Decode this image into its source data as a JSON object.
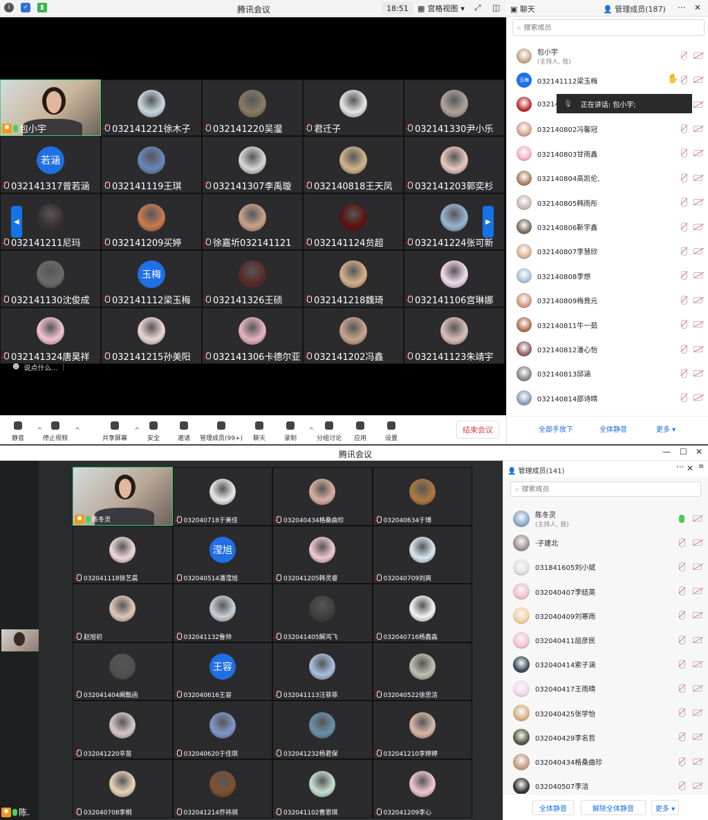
{
  "window1": {
    "title": "腾讯会议",
    "time": "18:51",
    "view_mode": "宫格视图",
    "chat_tab": "聊天",
    "members_tab": "管理成员(187)",
    "search_placeholder": "搜索成员",
    "say_something": "说点什么...",
    "speaking_prefix": "正在讲话: 包小宇;",
    "tiles": [
      {
        "name": "包小宇",
        "kind": "video",
        "c": "#c9b59a"
      },
      {
        "name": "032141221徐木子",
        "kind": "photo",
        "c": "#c8d8e0"
      },
      {
        "name": "032141220吴瀣",
        "kind": "photo",
        "c": "#8a7a66"
      },
      {
        "name": "君迁子",
        "kind": "photo",
        "c": "#e4e4e4"
      },
      {
        "name": "032141330尹小乐",
        "kind": "photo",
        "c": "#b0a49a"
      },
      {
        "name": "032141317曾若涵",
        "kind": "text",
        "avatar_text": "若涵"
      },
      {
        "name": "032141119王琪",
        "kind": "photo",
        "c": "#6a86b8"
      },
      {
        "name": "032141307李禹璇",
        "kind": "photo",
        "c": "#d7d7d7"
      },
      {
        "name": "032140818王天凤",
        "kind": "photo",
        "c": "#d0b48c"
      },
      {
        "name": "032141203郭奕杉",
        "kind": "photo",
        "c": "#e8c8c0"
      },
      {
        "name": "032141211尼玛",
        "kind": "photo",
        "c": "#3a3030"
      },
      {
        "name": "032141209买婷",
        "kind": "photo",
        "c": "#c87a50"
      },
      {
        "name": "徐嘉圻032141121",
        "kind": "photo",
        "c": "#c8a28a"
      },
      {
        "name": "032141124贠超",
        "kind": "photo",
        "c": "#5a1410"
      },
      {
        "name": "032141224张可新",
        "kind": "photo",
        "c": "#9ab4d0"
      },
      {
        "name": "032141130沈俊成",
        "kind": "photo",
        "c": "#6a6a6a"
      },
      {
        "name": "032141112梁玉梅",
        "kind": "text",
        "avatar_text": "玉梅"
      },
      {
        "name": "032141326王硕",
        "kind": "photo",
        "c": "#5a2a2a"
      },
      {
        "name": "032141218魏琦",
        "kind": "photo",
        "c": "#d4b08a"
      },
      {
        "name": "032141106宫琳娜",
        "kind": "photo",
        "c": "#f0dcec"
      },
      {
        "name": "032141324唐昊祥",
        "kind": "photo",
        "c": "#f2c4d0"
      },
      {
        "name": "032141215孙美阳",
        "kind": "photo",
        "c": "#ecd8d4"
      },
      {
        "name": "032141306卡德尔亚",
        "kind": "photo",
        "c": "#e8b4c0"
      },
      {
        "name": "032141202冯鑫",
        "kind": "photo",
        "c": "#caa48e"
      },
      {
        "name": "032141123朱靖宇",
        "kind": "photo",
        "c": "#d8c0b8"
      }
    ],
    "toolbar": [
      {
        "label": "静音",
        "icon": "mic-icon"
      },
      {
        "label": "停止视频",
        "icon": "camera-icon"
      },
      {
        "label": "共享屏幕",
        "icon": "share-screen-icon"
      },
      {
        "label": "安全",
        "icon": "shield-icon"
      },
      {
        "label": "邀请",
        "icon": "add-user-icon"
      },
      {
        "label": "管理成员(99+)",
        "icon": "members-icon"
      },
      {
        "label": "聊天",
        "icon": "chat-icon"
      },
      {
        "label": "录制",
        "icon": "record-icon"
      },
      {
        "label": "分组讨论",
        "icon": "breakout-icon"
      },
      {
        "label": "应用",
        "icon": "apps-icon"
      },
      {
        "label": "设置",
        "icon": "gear-icon"
      }
    ],
    "end_meeting": "结束会议",
    "members": [
      {
        "name": "包小宇",
        "sub": "(主持人, 我)",
        "c": "#c6a890"
      },
      {
        "name": "032141112梁玉梅",
        "text_avatar": "玉梅",
        "hand": true
      },
      {
        "name": "032141",
        "c": "#b83030"
      },
      {
        "name": "032140802冯馨冠",
        "c": "#d2a490"
      },
      {
        "name": "032140803甘雨鑫",
        "c": "#f0b0c8"
      },
      {
        "name": "032140804高凯伦,",
        "c": "#a88060"
      },
      {
        "name": "032140805韩雨彤",
        "c": "#c8b8b0"
      },
      {
        "name": "032140806靳宇鑫",
        "c": "#7a6a5a"
      },
      {
        "name": "032140807李慧欣",
        "c": "#d8b090"
      },
      {
        "name": "032140808李想",
        "c": "#a8c0d8"
      },
      {
        "name": "032140809梅竟元",
        "c": "#d09880"
      },
      {
        "name": "032140811牛一茹",
        "c": "#b07050"
      },
      {
        "name": "032140812潘心怡",
        "c": "#906060"
      },
      {
        "name": "032140813邱涵",
        "c": "#888"
      },
      {
        "name": "032140814邵诗晴",
        "c": "#8aa0b8"
      }
    ],
    "panel_buttons": [
      "全部手放下",
      "全体静音",
      "更多 ▾"
    ]
  },
  "window2": {
    "title": "腾讯会议",
    "members_tab": "管理成员(141)",
    "search_placeholder": "搜索成员",
    "self_name": "陈.",
    "tiles": [
      {
        "name": "陈冬灵",
        "kind": "video",
        "c": "#b8a898"
      },
      {
        "name": "032040718于美佳",
        "kind": "photo",
        "c": "#e8e8e8"
      },
      {
        "name": "032040434格桑曲珍",
        "kind": "photo",
        "c": "#d8b0a0"
      },
      {
        "name": "032040634于博",
        "kind": "photo",
        "c": "#b07a40"
      },
      {
        "name": "032041118徐艺晨",
        "kind": "photo",
        "c": "#f0d8d8"
      },
      {
        "name": "032040514潘滢旭",
        "kind": "text",
        "avatar_text": "滢旭"
      },
      {
        "name": "032041205韩灵睿",
        "kind": "photo",
        "c": "#f0c8d0"
      },
      {
        "name": "032040709刘爽",
        "kind": "photo",
        "c": "#d8e8f0"
      },
      {
        "name": "赵旭初",
        "kind": "photo",
        "c": "#e0c8b8"
      },
      {
        "name": "032041132鲁帅",
        "kind": "photo",
        "c": "#c8d0d8"
      },
      {
        "name": "032041405解鸿飞",
        "kind": "photo",
        "c": "#404040"
      },
      {
        "name": "032040716杨鑫淼",
        "kind": "photo",
        "c": "#f4f4f4"
      },
      {
        "name": "032041404阚甄函",
        "kind": "photo",
        "c": "#505050"
      },
      {
        "name": "032040616王容",
        "kind": "text",
        "avatar_text": "王容"
      },
      {
        "name": "032041113汪菲菲",
        "kind": "photo",
        "c": "#a8c0e0"
      },
      {
        "name": "032040522徐思洁",
        "kind": "photo",
        "c": "#c0c0b0"
      },
      {
        "name": "032041220辛苗",
        "kind": "photo",
        "c": "#d8c8c8"
      },
      {
        "name": "032040620于佳琪",
        "kind": "photo",
        "c": "#8098c8"
      },
      {
        "name": "032041232杨君保",
        "kind": "photo",
        "c": "#6a90a8"
      },
      {
        "name": "032041210李婷婷",
        "kind": "photo",
        "c": "#d8b8a8"
      },
      {
        "name": "032040708李桐",
        "kind": "photo",
        "c": "#e8d4b8"
      },
      {
        "name": "032041214乔祎祺",
        "kind": "photo",
        "c": "#805030"
      },
      {
        "name": "032041102曹恩琪",
        "kind": "photo",
        "c": "#c8e0d0"
      },
      {
        "name": "032041209李心",
        "kind": "photo",
        "c": "#f0c8d0"
      }
    ],
    "members": [
      {
        "name": "陈冬灵",
        "sub": "(主持人, 我)",
        "c": "#8aa8c8",
        "mic_on": true
      },
      {
        "name": "·子建北",
        "c": "#a09090"
      },
      {
        "name": "031841605刘小斌",
        "c": "#e0e0e0"
      },
      {
        "name": "032040407李结英",
        "c": "#f0c0c8"
      },
      {
        "name": "032040409刘寒雨",
        "c": "#f0d0a0"
      },
      {
        "name": "032040411屈彦民",
        "c": "#f4c0d0"
      },
      {
        "name": "032040414索子涵",
        "c": "#3a4a5a"
      },
      {
        "name": "032040417王雨晴",
        "c": "#f0d8e8"
      },
      {
        "name": "032040425张学怡",
        "c": "#d8b080"
      },
      {
        "name": "032040429李名哲",
        "c": "#505a40"
      },
      {
        "name": "032040434格桑曲珍",
        "c": "#c89880"
      },
      {
        "name": "032040507李洁",
        "c": "#303030"
      }
    ],
    "panel_buttons": [
      "全体静音",
      "解除全体静音",
      "更多 ▾"
    ]
  }
}
